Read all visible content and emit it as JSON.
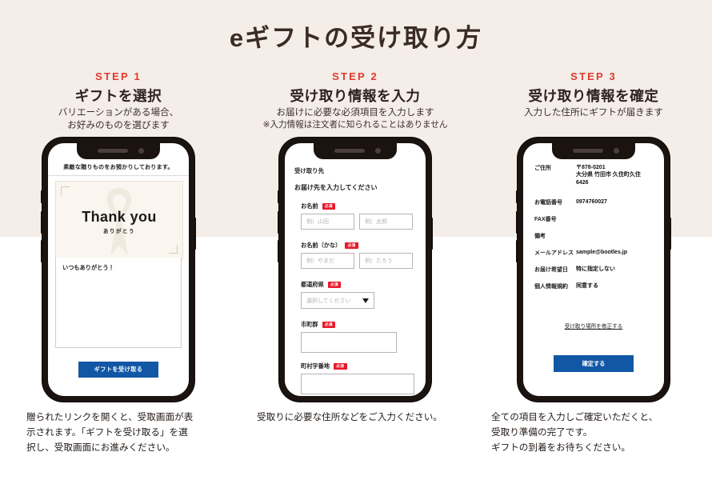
{
  "page": {
    "title": "eギフトの受け取り方",
    "background_top": "#F4EDE8",
    "background_bottom": "#FFFFFF",
    "accent_red": "#E03A2F",
    "button_blue": "#1257A5"
  },
  "steps": [
    {
      "label": "STEP 1",
      "title": "ギフトを選択",
      "desc_line1": "バリエーションがある場合、",
      "desc_line2": "お好みのものを選びます",
      "caption": [
        "贈られたリンクを開くと、受取画面が表",
        "示されます。「ギフトを受け取る」を選",
        "択し、受取画面にお進みください。"
      ]
    },
    {
      "label": "STEP 2",
      "title": "受け取り情報を入力",
      "desc_line1": "お届けに必要な必須項目を入力します",
      "desc_line2": "※入力情報は注文者に知られることはありません",
      "caption": [
        "受取りに必要な住所などをご入力ください。"
      ]
    },
    {
      "label": "STEP 3",
      "title": "受け取り情報を確定",
      "desc_line1": "入力した住所にギフトが届きます",
      "desc_line2": "",
      "caption": [
        "全ての項目を入力しご確定いただくと、",
        "受取り準備の完了です。",
        "ギフトの到着をお待ちください。"
      ]
    }
  ],
  "phone1": {
    "header": "素敵な贈りものをお預かりしております。",
    "card_title": "Thank you",
    "card_subtitle": "ありがとう",
    "message": "いつもありがとう！",
    "button": "ギフトを受け取る"
  },
  "phone2": {
    "heading": "受け取り先",
    "subheading": "お届け先を入力してください",
    "required_badge": "必須",
    "fields": [
      {
        "label": "お名前",
        "inputs": [
          {
            "placeholder": "例）山田"
          },
          {
            "placeholder": "例）太郎"
          }
        ]
      },
      {
        "label": "お名前（かな）",
        "inputs": [
          {
            "placeholder": "例）やまだ"
          },
          {
            "placeholder": "例）たろう"
          }
        ]
      },
      {
        "label": "都道府県",
        "select_value": "選択してください"
      },
      {
        "label": "市町群",
        "inputs": [
          {
            "placeholder": ""
          }
        ]
      },
      {
        "label": "町村字番地",
        "inputs": [
          {
            "placeholder": ""
          }
        ]
      }
    ]
  },
  "phone3": {
    "rows": [
      {
        "key": "ご住所",
        "value": "〒878-0201\n大分県 竹田市 久住町久住\n6426"
      },
      {
        "key": "お電話番号",
        "value": "0974760027"
      },
      {
        "key": "FAX番号",
        "value": ""
      },
      {
        "key": "備考",
        "value": ""
      },
      {
        "key": "メールアドレス",
        "value": "sample@bootles.jp"
      },
      {
        "key": "お届け希望日",
        "value": "特に指定しない"
      },
      {
        "key": "個人情報規約",
        "value": "同意する"
      }
    ],
    "edit_link": "受け取り場所を修正する",
    "button": "確定する"
  }
}
